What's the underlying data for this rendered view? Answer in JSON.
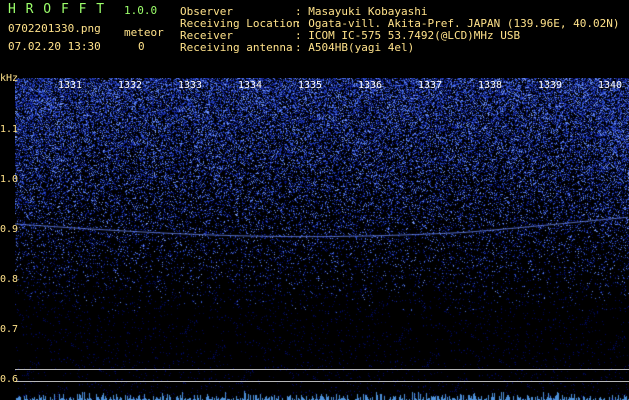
{
  "app": {
    "title": "H R O F F T",
    "version": "1.0.0",
    "filename": "0702201330.png",
    "datetime": "07.02.20 13:30",
    "meteor_label": "meteor",
    "meteor_count": "0"
  },
  "info": {
    "rows": [
      {
        "label": "Observer",
        "value": ": Masayuki Kobayashi"
      },
      {
        "label": "Receiving Location",
        "value": ": Ogata-vill. Akita-Pref. JAPAN (139.96E, 40.02N)"
      },
      {
        "label": "Receiver",
        "value": ": ICOM IC-575 53.7492(@LCD)MHz USB"
      },
      {
        "label": "Receiving antenna",
        "value": ": A504HB(yagi 4el)"
      }
    ]
  },
  "axis": {
    "y_unit": "kHz",
    "y_ticks": [
      "1.1",
      "1.0",
      "0.9",
      "0.8",
      "0.7",
      "0.6"
    ],
    "time_ticks": [
      "1331",
      "1332",
      "1333",
      "1334",
      "1335",
      "1336",
      "1337",
      "1338",
      "1339",
      "1340"
    ]
  },
  "colors": {
    "noise": "#2c46d8",
    "background": "#000000",
    "trace": "#6f8dff",
    "header_green": "#9cff6b",
    "header_yellow": "#ffe28a"
  }
}
